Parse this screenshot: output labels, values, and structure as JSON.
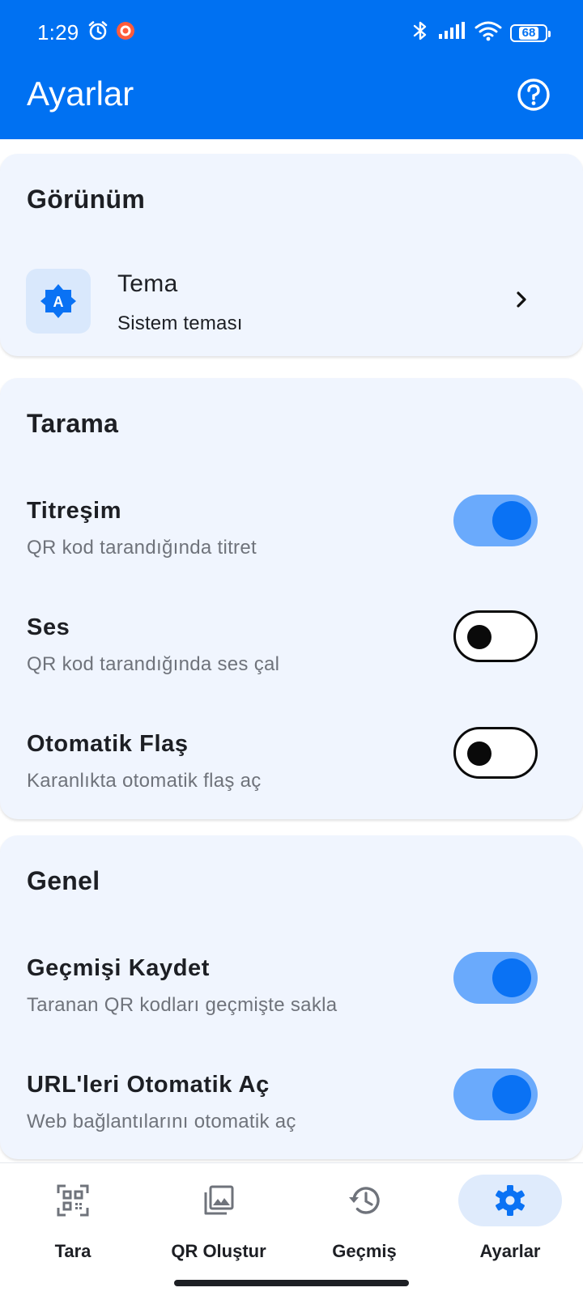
{
  "status_bar": {
    "time": "1:29",
    "battery": "68"
  },
  "app_bar": {
    "title": "Ayarlar"
  },
  "sections": {
    "appearance": {
      "title": "Görünüm",
      "theme": {
        "title": "Tema",
        "subtitle": "Sistem teması"
      }
    },
    "scanning": {
      "title": "Tarama",
      "items": [
        {
          "title": "Titreşim",
          "subtitle": "QR kod tarandığında titret",
          "enabled": true
        },
        {
          "title": "Ses",
          "subtitle": "QR kod tarandığında ses çal",
          "enabled": false
        },
        {
          "title": "Otomatik Flaş",
          "subtitle": "Karanlıkta otomatik flaş aç",
          "enabled": false
        }
      ]
    },
    "general": {
      "title": "Genel",
      "items": [
        {
          "title": "Geçmişi Kaydet",
          "subtitle": "Taranan QR kodları geçmişte sakla",
          "enabled": true
        },
        {
          "title": "URL'leri Otomatik Aç",
          "subtitle": "Web bağlantılarını otomatik aç",
          "enabled": true
        }
      ]
    }
  },
  "bottom_nav": {
    "items": [
      {
        "label": "Tara",
        "icon": "qr-scan-icon",
        "active": false
      },
      {
        "label": "QR Oluştur",
        "icon": "image-icon",
        "active": false
      },
      {
        "label": "Geçmiş",
        "icon": "history-icon",
        "active": false
      },
      {
        "label": "Ayarlar",
        "icon": "gear-icon",
        "active": true
      }
    ]
  },
  "colors": {
    "primary": "#0071f2",
    "card_background": "#f0f5fe",
    "switch_track_on": "#6aaafc",
    "switch_knob_on": "#0a72f4",
    "inactive_icon": "#6f737b",
    "active_pill": "#dfebfc"
  }
}
